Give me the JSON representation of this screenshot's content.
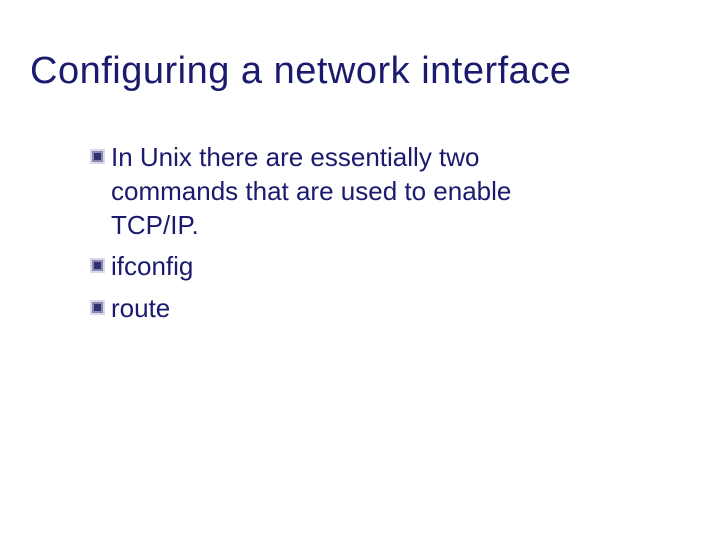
{
  "slide": {
    "title": "Configuring a network interface",
    "bullets": [
      {
        "text": "In Unix there are essentially two commands that are used to enable TCP/IP."
      },
      {
        "text": "ifconfig"
      },
      {
        "text": "route"
      }
    ]
  }
}
